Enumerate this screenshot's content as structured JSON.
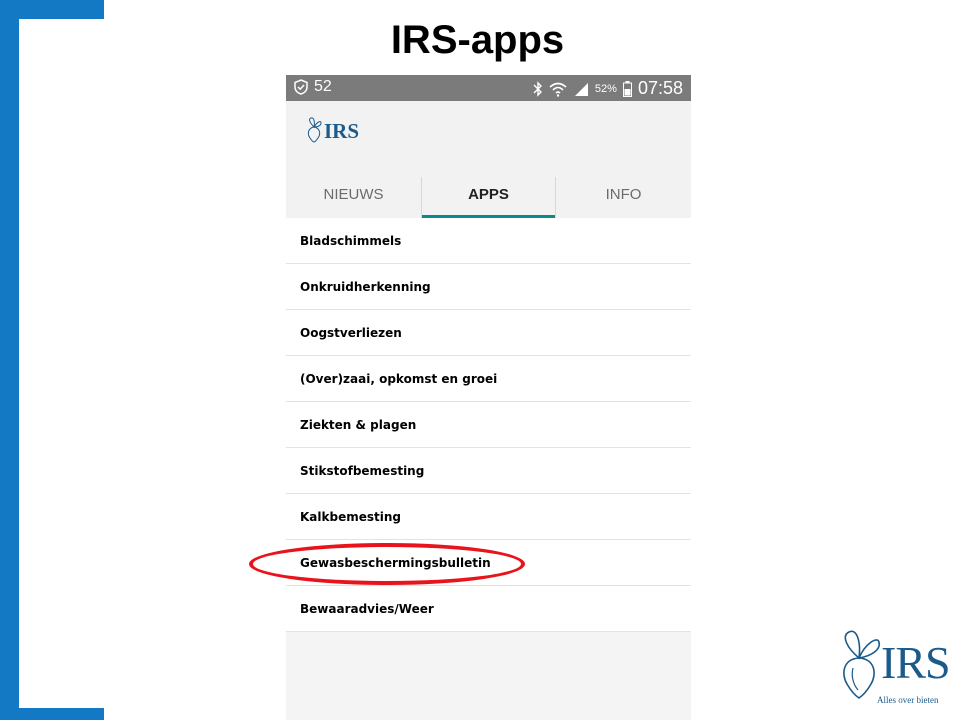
{
  "slide": {
    "title": "IRS-apps",
    "accent_color": "#1479c4",
    "highlight_color": "#e8131b"
  },
  "status_bar": {
    "notification_count": "52",
    "battery_percent": "52%",
    "time": "07:58",
    "icons": [
      "shield-check-icon",
      "bluetooth-icon",
      "wifi-icon",
      "signal-icon",
      "battery-icon"
    ]
  },
  "app": {
    "logo_text": "IRS",
    "tab_indicator_color": "#0a8a8a",
    "tabs": [
      {
        "label": "NIEUWS"
      },
      {
        "label": "APPS"
      },
      {
        "label": "INFO"
      }
    ],
    "active_tab": "APPS",
    "items": [
      {
        "label": "Bladschimmels"
      },
      {
        "label": "Onkruidherkenning"
      },
      {
        "label": "Oogstverliezen"
      },
      {
        "label": "(Over)zaai, opkomst en groei"
      },
      {
        "label": "Ziekten & plagen"
      },
      {
        "label": "Stikstofbemesting"
      },
      {
        "label": "Kalkbemesting"
      },
      {
        "label": "Gewasbeschermingsbulletin"
      },
      {
        "label": "Bewaaradvies/Weer"
      }
    ],
    "highlighted_item": "Gewasbeschermingsbulletin"
  },
  "corner_logo": {
    "text": "IRS",
    "tagline": "Alles over bieten"
  }
}
